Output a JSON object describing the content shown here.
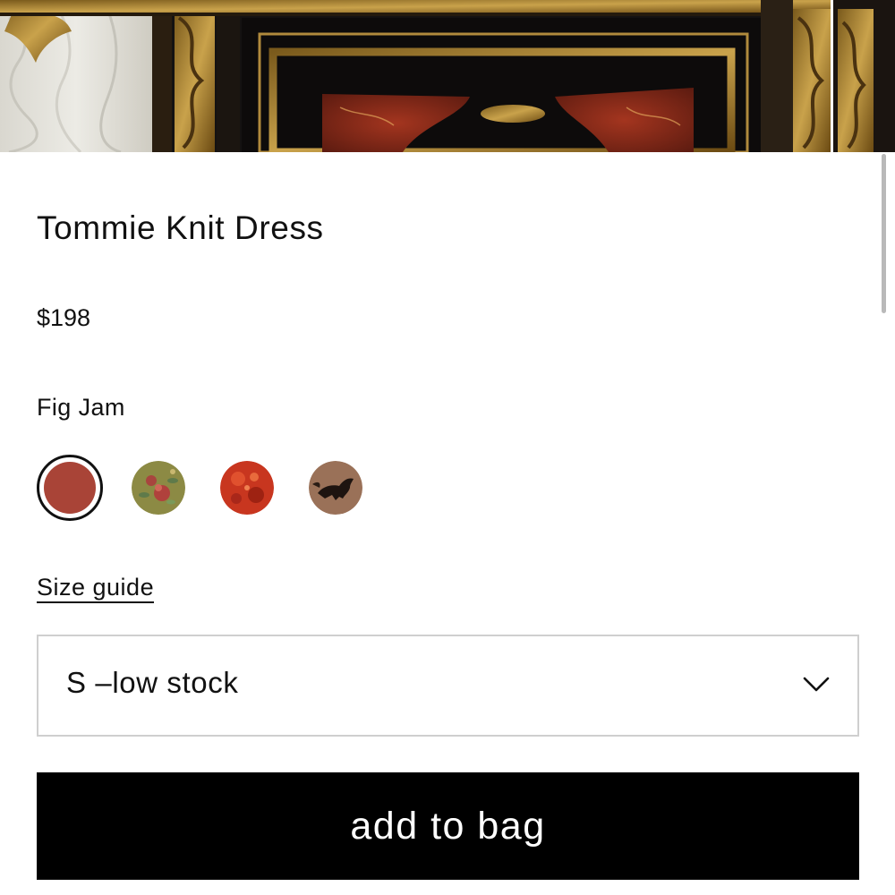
{
  "product": {
    "title": "Tommie Knit Dress",
    "price": "$198",
    "color_name": "Fig Jam"
  },
  "swatches": [
    {
      "name": "Fig Jam",
      "selected": true,
      "color": "#a94437"
    },
    {
      "name": "floral-olive",
      "selected": false,
      "color": "#8c8a44"
    },
    {
      "name": "red-floral",
      "selected": false,
      "color": "#c8361f"
    },
    {
      "name": "horse-print",
      "selected": false,
      "color": "#9a7158"
    }
  ],
  "size_guide_label": "Size guide",
  "size_select": {
    "value": "S –low stock",
    "icon": "chevron-down-icon"
  },
  "add_to_bag_label": "add to bag",
  "colors": {
    "button_bg": "#000000",
    "button_text": "#ffffff",
    "select_border": "#cfcfcf",
    "selected_swatch": "#a94437"
  }
}
